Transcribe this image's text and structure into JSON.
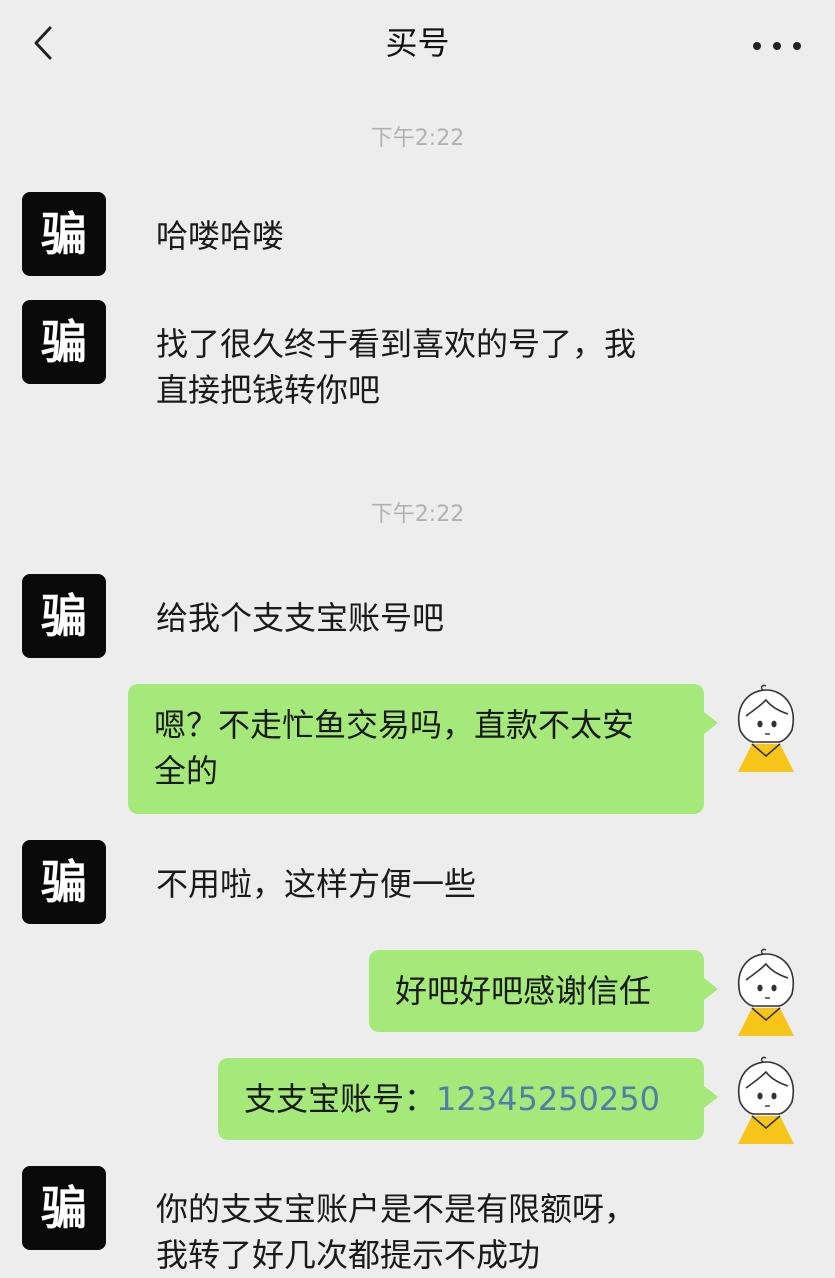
{
  "header": {
    "title": "买号"
  },
  "avatars": {
    "scammer_label": "骗"
  },
  "timestamps": [
    "下午2:22",
    "下午2:22"
  ],
  "messages": [
    {
      "side": "left",
      "line1": "哈喽哈喽"
    },
    {
      "side": "left",
      "line1": "找了很久终于看到喜欢的号了，我",
      "line2": "直接把钱转你吧"
    },
    {
      "side": "left",
      "line1": "给我个支支宝账号吧"
    },
    {
      "side": "right",
      "line1": "嗯？不走忙鱼交易吗，直款不太安",
      "line2": "全的"
    },
    {
      "side": "left",
      "line1": "不用啦，这样方便一些"
    },
    {
      "side": "right",
      "line1": "好吧好吧感谢信任"
    },
    {
      "side": "right",
      "prefix": "支支宝账号：",
      "number": "12345250250"
    },
    {
      "side": "left",
      "line1": "你的支支宝账户是不是有限额呀，",
      "line2": "我转了好几次都提示不成功"
    }
  ]
}
